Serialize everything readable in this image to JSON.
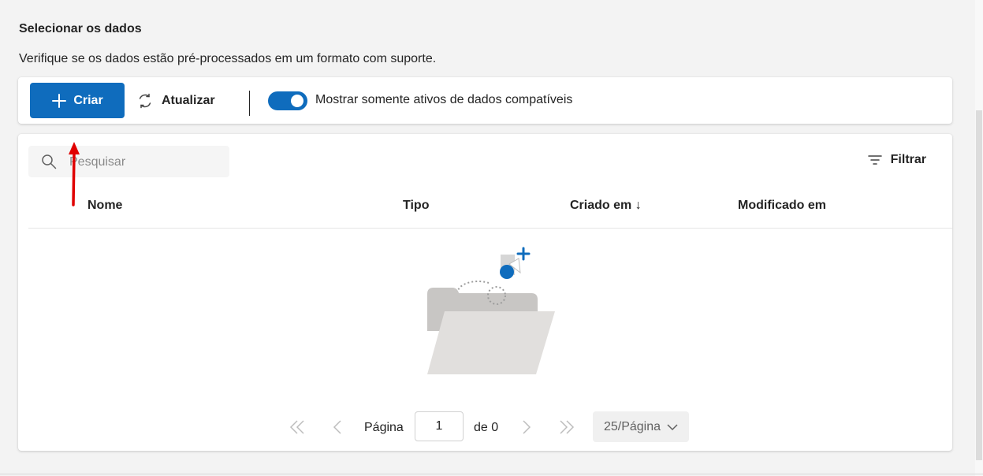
{
  "section": {
    "title": "Selecionar os dados",
    "description": "Verifique se os dados estão pré-processados em um formato com suporte."
  },
  "toolbar": {
    "create_label": "Criar",
    "refresh_label": "Atualizar",
    "toggle_label": "Mostrar somente ativos de dados compatíveis",
    "toggle_on": true
  },
  "search": {
    "placeholder": "Pesquisar"
  },
  "filter_label": "Filtrar",
  "table": {
    "columns": [
      "Nome",
      "Tipo",
      "Criado em ↓",
      "Modificado em"
    ]
  },
  "pagination": {
    "page_label": "Página",
    "current_page": "1",
    "of_label": "de 0",
    "page_size": "25/Página"
  },
  "colors": {
    "accent": "#0f6cbd",
    "annotation_arrow": "#e00000"
  }
}
